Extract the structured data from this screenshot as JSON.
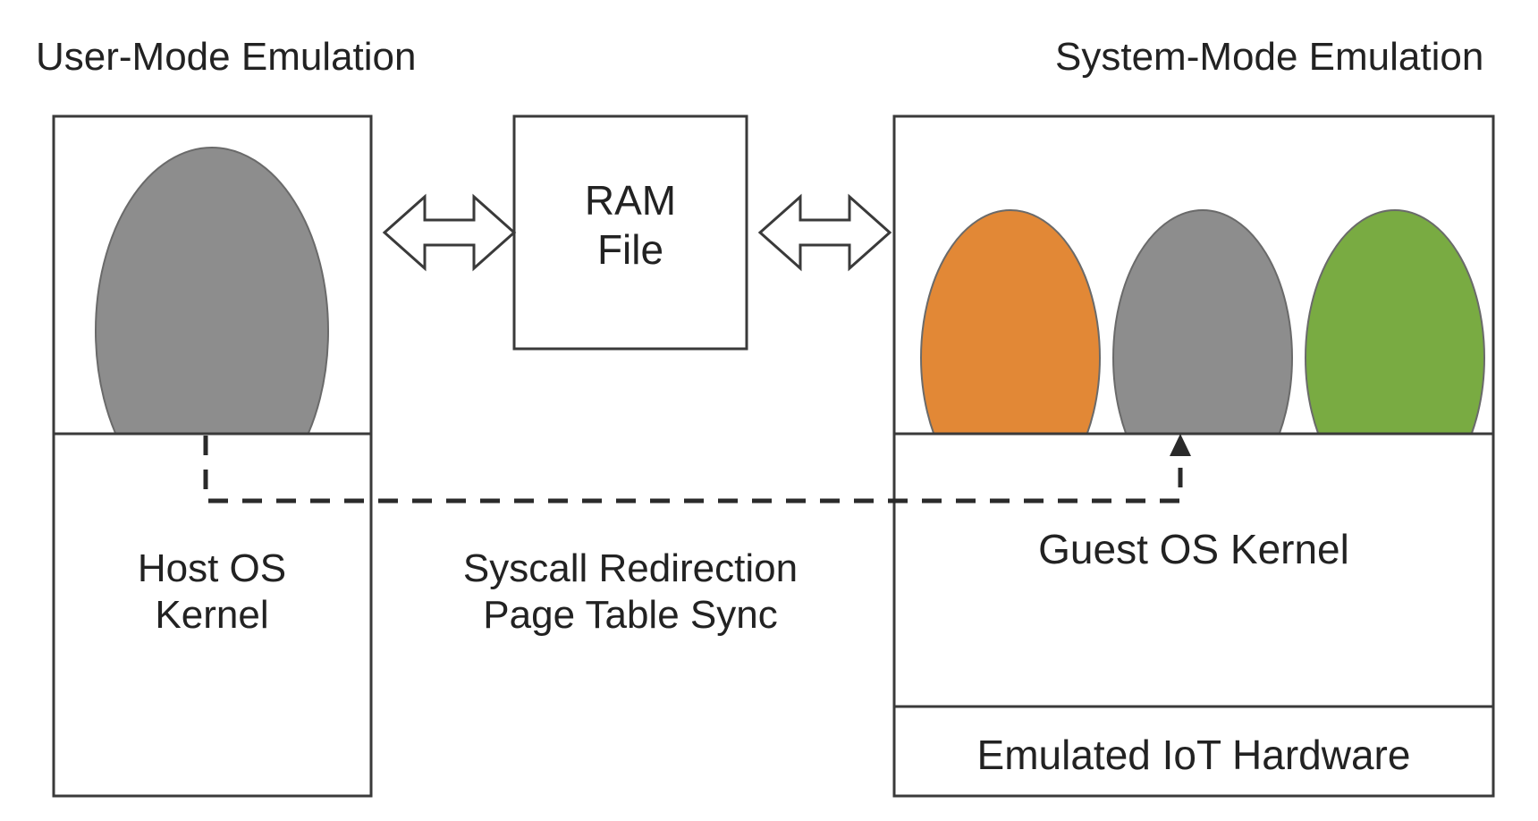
{
  "titles": {
    "left": "User-Mode Emulation",
    "right": "System-Mode Emulation"
  },
  "boxes": {
    "ram_line1": "RAM",
    "ram_line2": "File",
    "host_line1": "Host OS",
    "host_line2": "Kernel",
    "guest": "Guest OS Kernel",
    "hardware": "Emulated IoT Hardware"
  },
  "center_label": {
    "line1": "Syscall Redirection",
    "line2": "Page Table Sync"
  },
  "colors": {
    "stroke": "#3a3a3a",
    "orange_fill": "#e28836",
    "gray_fill": "#8d8d8d",
    "green_fill": "#79ab42",
    "ellipse_stroke": "#6a6a6a"
  }
}
